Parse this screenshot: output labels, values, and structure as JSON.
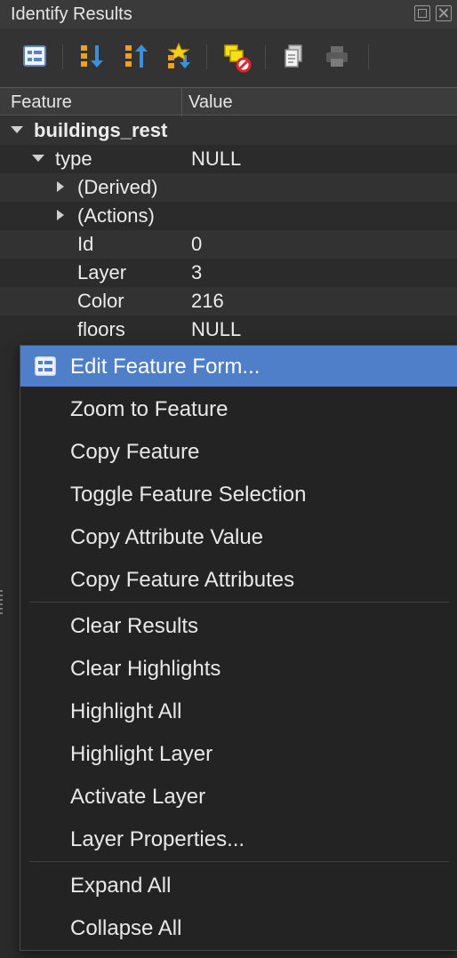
{
  "panel": {
    "title": "Identify Results"
  },
  "toolbar": {
    "buttons": [
      {
        "icon": "form-view-icon"
      },
      {
        "icon": "expand-tree-icon"
      },
      {
        "icon": "collapse-tree-icon"
      },
      {
        "icon": "expand-new-results-icon"
      },
      {
        "icon": "deselect-icon"
      },
      {
        "icon": "copy-icon"
      },
      {
        "icon": "print-icon"
      }
    ]
  },
  "tree": {
    "headers": {
      "feature": "Feature",
      "value": "Value"
    },
    "layer_name": "buildings_rest",
    "rows": [
      {
        "label": "type",
        "value": "NULL"
      },
      {
        "label": "(Derived)"
      },
      {
        "label": "(Actions)"
      },
      {
        "label": "Id",
        "value": "0"
      },
      {
        "label": "Layer",
        "value": "3"
      },
      {
        "label": "Color",
        "value": "216"
      },
      {
        "label": "floors",
        "value": "NULL"
      }
    ]
  },
  "context_menu": {
    "items": [
      "Edit Feature Form...",
      "Zoom to Feature",
      "Copy Feature",
      "Toggle Feature Selection",
      "Copy Attribute Value",
      "Copy Feature Attributes",
      "Clear Results",
      "Clear Highlights",
      "Highlight All",
      "Highlight Layer",
      "Activate Layer",
      "Layer Properties...",
      "Expand All",
      "Collapse All"
    ],
    "active_index": 0,
    "accent_color": "#4e7fc8"
  }
}
